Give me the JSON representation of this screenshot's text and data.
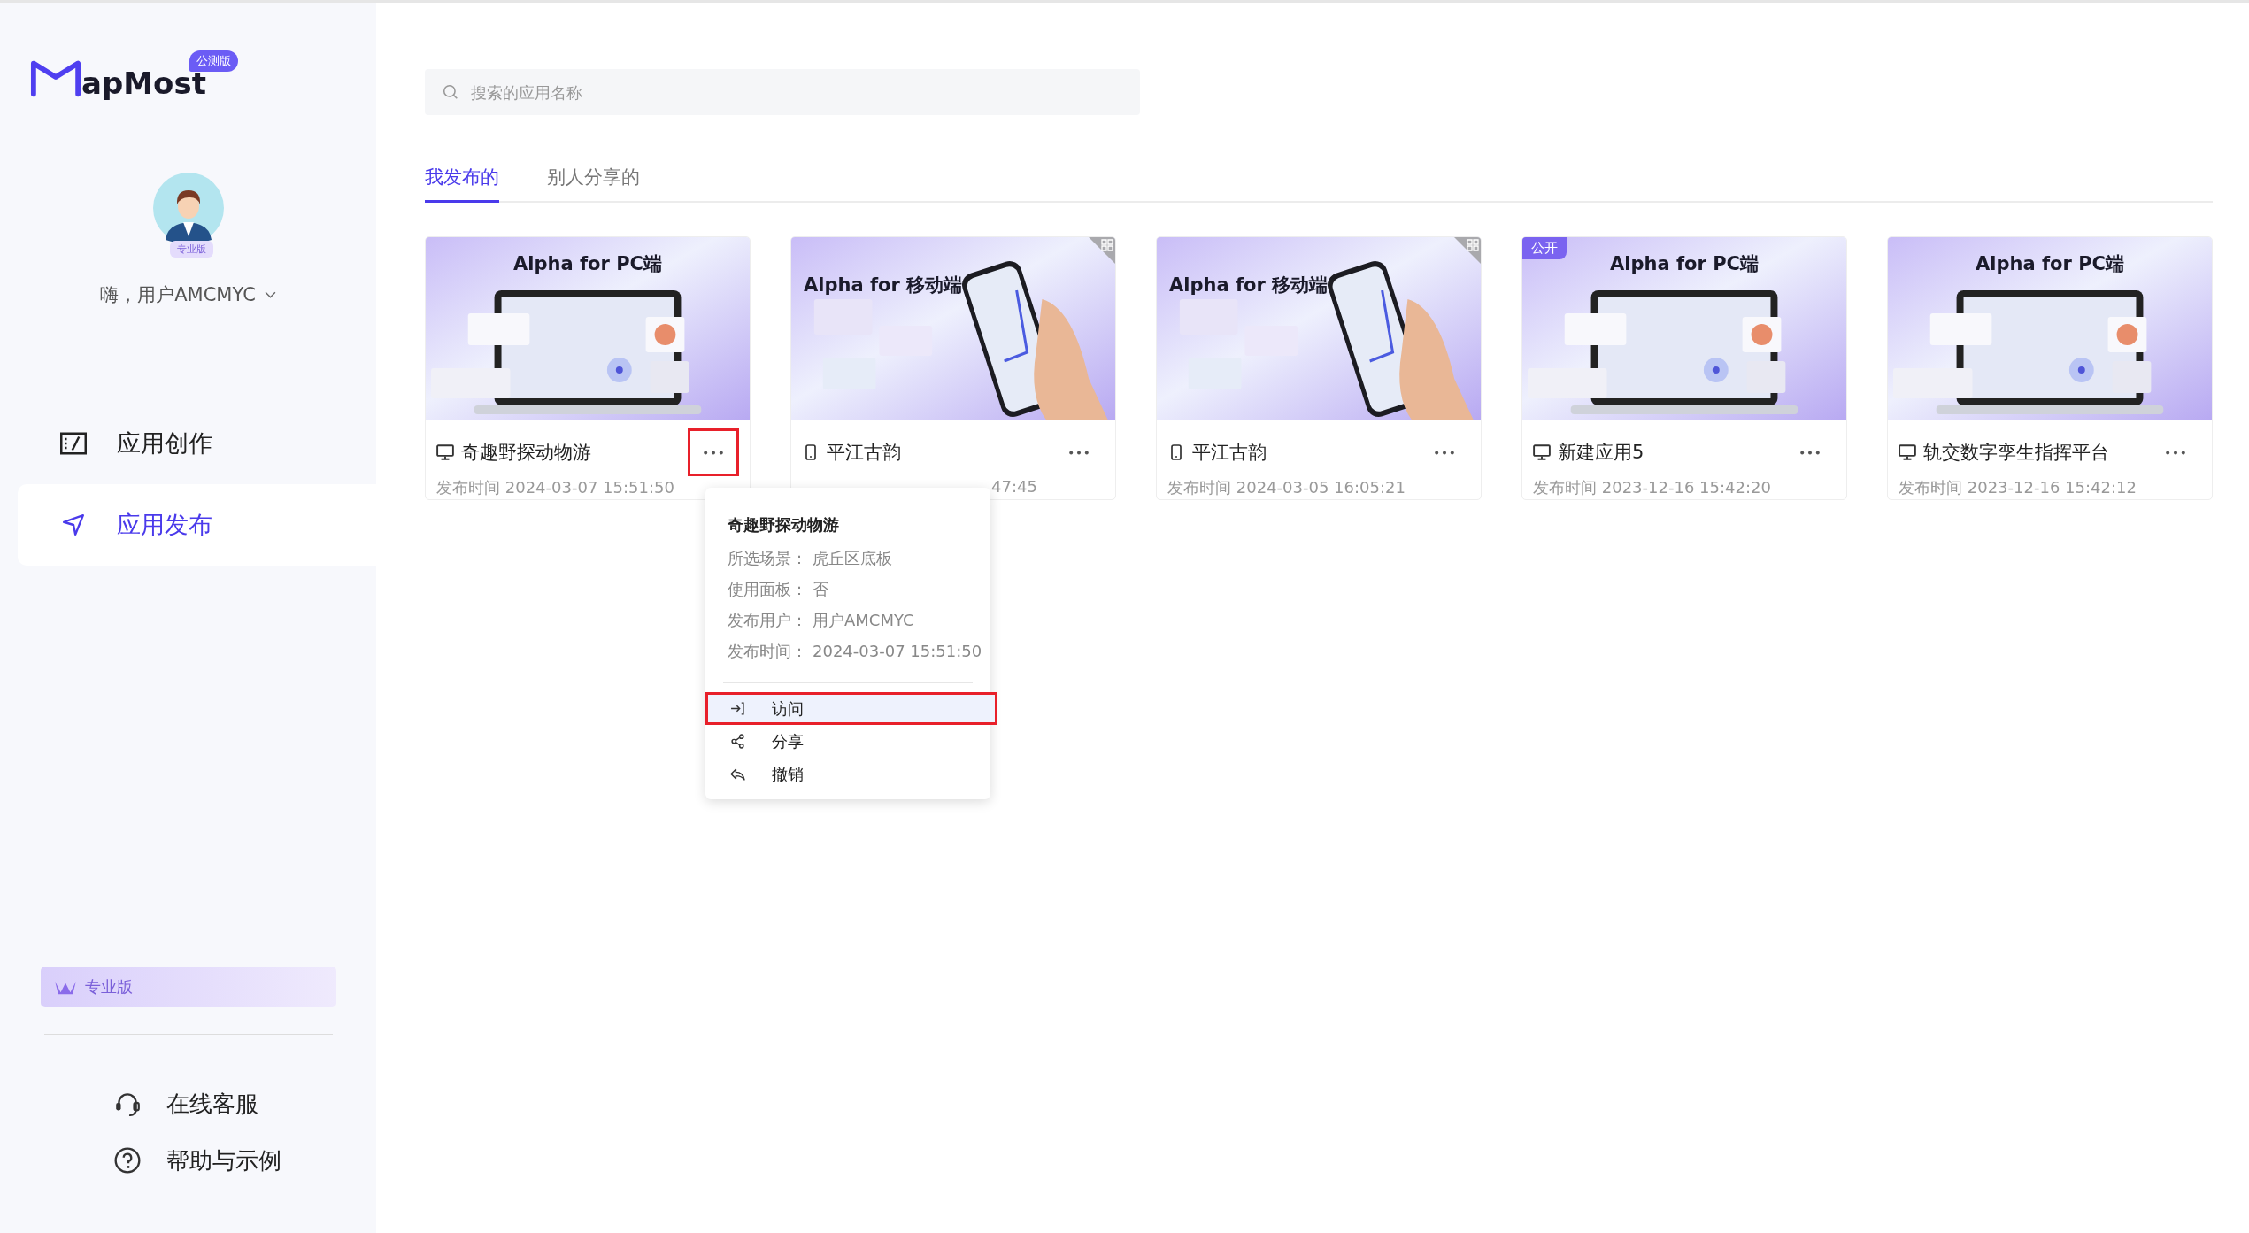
{
  "brand": {
    "name": "apMost",
    "badge": "公测版"
  },
  "user": {
    "level_badge": "专业版",
    "greeting": "嗨，用户AMCMYC"
  },
  "nav": [
    {
      "label": "应用创作",
      "kind": "edit",
      "selected": false
    },
    {
      "label": "应用发布",
      "kind": "send",
      "selected": true
    }
  ],
  "plan_banner": {
    "label": "专业版"
  },
  "footer_links": [
    {
      "label": "在线客服",
      "kind": "headset"
    },
    {
      "label": "帮助与示例",
      "kind": "help"
    }
  ],
  "search": {
    "placeholder": "搜索的应用名称"
  },
  "tabs": [
    {
      "label": "我发布的",
      "selected": true
    },
    {
      "label": "别人分享的",
      "selected": false
    }
  ],
  "cards": [
    {
      "thumb_title": "Alpha for PC端",
      "kind": "pc",
      "qr": false,
      "name": "奇趣野探动物游",
      "date": "发布时间 2024-03-07 15:51:50",
      "covered": false,
      "more_highlighted": true
    },
    {
      "thumb_title": "Alpha for 移动端",
      "kind": "mobile",
      "qr": true,
      "name": "平江古韵",
      "date": "47:45",
      "covered": true,
      "more_highlighted": false
    },
    {
      "thumb_title": "Alpha for 移动端",
      "kind": "mobile",
      "qr": true,
      "name": "平江古韵",
      "date": "发布时间 2024-03-05 16:05:21",
      "covered": false,
      "more_highlighted": false
    },
    {
      "thumb_title": "Alpha for PC端",
      "kind": "pc",
      "tag": "公开",
      "qr": false,
      "name": "新建应用5",
      "date": "发布时间 2023-12-16 15:42:20",
      "covered": false,
      "more_highlighted": false
    },
    {
      "thumb_title": "Alpha for PC端",
      "kind": "pc",
      "qr": false,
      "name": "轨交数字孪生指挥平台",
      "date": "发布时间 2023-12-16 15:42:12",
      "covered": false,
      "more_highlighted": false
    }
  ],
  "popup": {
    "title": "奇趣野探动物游",
    "details": [
      {
        "label": "所选场景：",
        "value": "虎丘区底板"
      },
      {
        "label": "使用面板：",
        "value": "否"
      },
      {
        "label": "发布用户：",
        "value": "用户AMCMYC"
      },
      {
        "label": "发布时间：",
        "value": "2024-03-07 15:51:50"
      }
    ],
    "actions": [
      {
        "label": "访问",
        "kind": "enter",
        "selected": true
      },
      {
        "label": "分享",
        "kind": "share",
        "selected": false
      },
      {
        "label": "撤销",
        "kind": "revoke",
        "selected": false
      }
    ]
  }
}
